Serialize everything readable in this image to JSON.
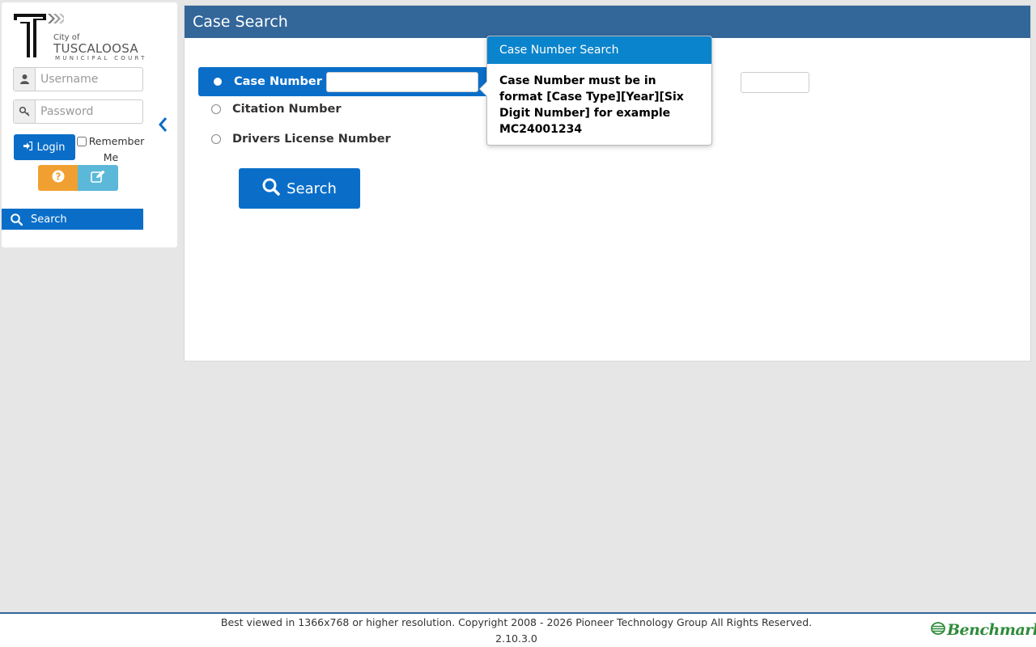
{
  "sidebar": {
    "logo": {
      "city": "City of",
      "name": "TUSCALOOSA",
      "subtitle": "MUNICIPAL COURT"
    },
    "username": {
      "placeholder": "Username",
      "value": ""
    },
    "password": {
      "placeholder": "Password",
      "value": ""
    },
    "login_label": "Login",
    "remember_label_1": "Remember",
    "remember_label_2": "Me",
    "nav": [
      {
        "label": "Search",
        "icon": "search-icon",
        "active": true
      }
    ]
  },
  "main": {
    "title": "Case Search",
    "options": [
      {
        "label": "Case Number",
        "selected": true
      },
      {
        "label": "Citation Number",
        "selected": false
      },
      {
        "label": "Drivers License Number",
        "selected": false
      }
    ],
    "search_label": "Search"
  },
  "popover": {
    "title": "Case Number Search",
    "body": "Case Number must be in format [Case Type][Year][Six Digit Number] for example MC24001234"
  },
  "footer": {
    "copyright": "Best viewed in 1366x768 or higher resolution. Copyright 2008 - 2026 Pioneer Technology Group All Rights Reserved.",
    "version": "2.10.3.0",
    "brand": "Benchmark"
  },
  "colors": {
    "primary": "#0a6ec9",
    "header": "#336699",
    "help": "#f0a030",
    "edit": "#5bb8d9",
    "brand": "#2e8b3a"
  }
}
